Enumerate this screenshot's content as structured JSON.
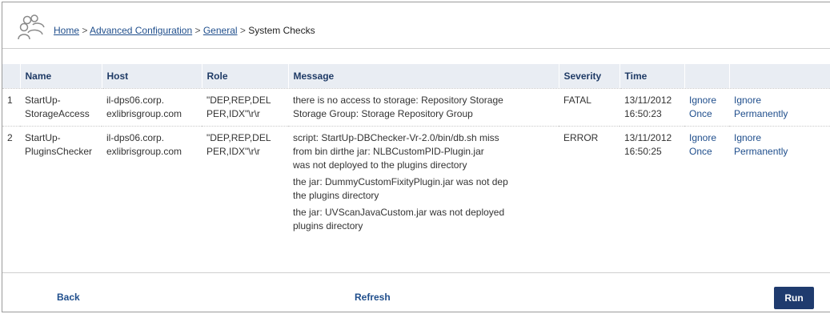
{
  "breadcrumb": {
    "home": "Home",
    "sep": ">",
    "advanced": "Advanced Configuration",
    "general": "General",
    "current": "System Checks"
  },
  "table": {
    "headers": [
      "",
      "Name",
      "Host",
      "Role",
      "Message",
      "Severity",
      "Time",
      "",
      ""
    ],
    "rows": [
      {
        "index": "1",
        "name": [
          "StartUp-",
          "StorageAccess"
        ],
        "host": [
          "il-dps06.corp.",
          "exlibrisgroup.com"
        ],
        "role": [
          "\"DEP,REP,DEL",
          "PER,IDX\"\\r\\r"
        ],
        "message": [
          "there is no access to storage: Repository Storage",
          "Storage Group: Storage Repository Group"
        ],
        "severity": "FATAL",
        "time": [
          "13/11/2012",
          "16:50:23"
        ],
        "ignore_once": [
          "Ignore",
          "Once"
        ],
        "ignore_perm": [
          "Ignore",
          "Permanently"
        ]
      },
      {
        "index": "2",
        "name": [
          "StartUp-",
          "PluginsChecker"
        ],
        "host": [
          "il-dps06.corp.",
          "exlibrisgroup.com"
        ],
        "role": [
          "\"DEP,REP,DEL",
          "PER,IDX\"\\r\\r"
        ],
        "message": [
          "script: StartUp-DBChecker-Vr-2.0/bin/db.sh miss",
          "from bin dirthe jar: NLBCustomPID-Plugin.jar",
          "was not deployed to the plugins directory",
          "the jar: DummyCustomFixityPlugin.jar was not dep",
          "the plugins directory",
          "the jar: UVScanJavaCustom.jar was not deployed",
          "plugins directory"
        ],
        "severity": "ERROR",
        "time": [
          "13/11/2012",
          "16:50:25"
        ],
        "ignore_once": [
          "Ignore",
          "Once"
        ],
        "ignore_perm": [
          "Ignore",
          "Permanently"
        ]
      }
    ]
  },
  "footer": {
    "back": "Back",
    "refresh": "Refresh",
    "run": "Run"
  },
  "colors": {
    "header_bg": "#e9edf3",
    "header_text": "#1f3b66",
    "link": "#1f4e8c",
    "run_button": "#1f3b6e"
  },
  "icons": {
    "logo": "users-group-icon"
  }
}
